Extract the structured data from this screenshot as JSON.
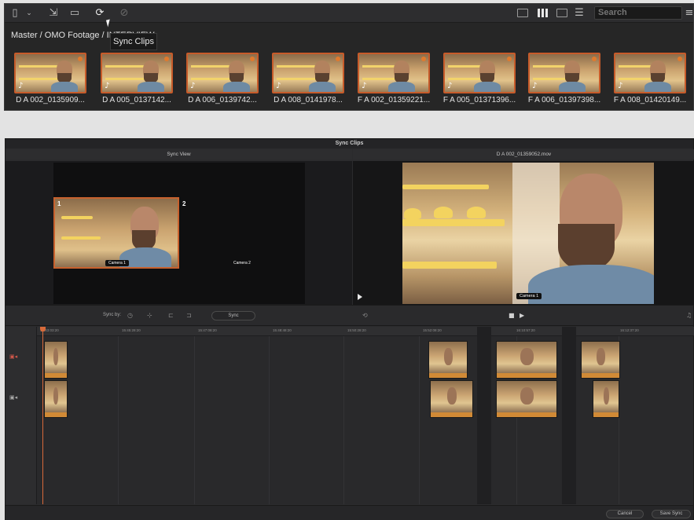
{
  "toolbar": {
    "search_placeholder": "Search"
  },
  "breadcrumb": "Master / OMO Footage / INTERVIEW",
  "tooltip": "Sync Clips",
  "clips": [
    {
      "label": "D A 002_0135909..."
    },
    {
      "label": "D A 005_0137142..."
    },
    {
      "label": "D A 006_0139742..."
    },
    {
      "label": "D A 008_0141978..."
    },
    {
      "label": "F A 002_01359221..."
    },
    {
      "label": "F A 005_01371396..."
    },
    {
      "label": "F A 006_01397398..."
    },
    {
      "label": "F A 008_01420149..."
    }
  ],
  "sync_window": {
    "title": "Sync Clips",
    "left_header": "Sync View",
    "right_header": "D A 002_01359052.mov",
    "camera1_number": "1",
    "camera2_number": "2",
    "camera1_label": "Camera 1",
    "camera2_label": "Camera 2",
    "viewer_camera_label": "Camera 1",
    "sync_by_label": "Sync by:",
    "sync_button": "Sync",
    "cancel_button": "Cancel",
    "save_sync_button": "Save Sync",
    "ruler_ticks": [
      "15:43:03:20",
      "15:45:28:20",
      "15:47:08:20",
      "15:48:48:20",
      "15:50:28:20",
      "15:52:08:20",
      "16:10:57:20",
      "16:12:37:20"
    ]
  },
  "colors": {
    "accent": "#c75b2a",
    "clip_orange": "#d18a36",
    "playhead": "#d86a3a"
  }
}
